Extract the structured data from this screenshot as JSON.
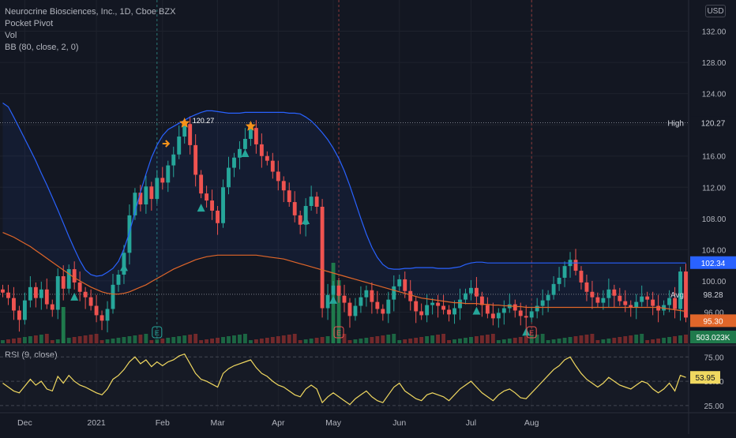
{
  "legend": {
    "title": "Neurocrine Biosciences, Inc., 1D, Cboe BZX",
    "indicator1": "Pocket Pivot",
    "indicator2": "Vol",
    "indicator3": "BB (80, close, 2, 0)"
  },
  "currency_button": "USD",
  "colors": {
    "background": "#131722",
    "bb_band": "#2962ff",
    "bb_basis": "#e0662a",
    "up": "#26a69a",
    "down": "#ef5350",
    "rsi": "#f0d860",
    "high_line": "#2962ff",
    "earnings": "#ef5350"
  },
  "chart_data": [
    {
      "type": "candlestick",
      "ylim": [
        92,
        136
      ],
      "y_ticks": [
        "132.00",
        "128.00",
        "124.00",
        "120.00",
        "116.00",
        "112.00",
        "108.00",
        "104.00",
        "100.00",
        "96.00"
      ],
      "x_ticks": [
        "Dec",
        "2021",
        "Feb",
        "Mar",
        "Apr",
        "May",
        "Jun",
        "Jul",
        "Aug"
      ],
      "price_labels": {
        "high_label": "High",
        "high_value": "120.27",
        "upper_band_value": "102.34",
        "avg_label": "Avg",
        "avg_value": "98.28",
        "last_value": "95.30",
        "volume_value": "503.023K"
      },
      "annotations": {
        "peak_label": "120.27",
        "earnings_marker": "E"
      },
      "series_close": [
        98.5,
        97.8,
        96.2,
        95.0,
        97.5,
        99.2,
        97.8,
        98.9,
        97.0,
        96.3,
        100.6,
        99.0,
        101.5,
        99.8,
        98.6,
        97.9,
        96.8,
        95.6,
        94.9,
        96.4,
        99.5,
        100.8,
        103.6,
        108.4,
        111.3,
        109.8,
        112.1,
        110.5,
        113.2,
        112.6,
        114.8,
        116.2,
        118.5,
        120.1,
        117.4,
        113.6,
        111.2,
        110.3,
        109.0,
        107.4,
        112.0,
        114.5,
        115.8,
        116.9,
        118.2,
        119.6,
        117.5,
        116.0,
        115.4,
        114.0,
        112.8,
        111.6,
        110.1,
        108.4,
        107.2,
        109.6,
        110.8,
        109.5,
        96.5,
        98.2,
        99.4,
        98.1,
        97.2,
        95.5,
        96.8,
        97.9,
        98.8,
        97.3,
        96.4,
        95.8,
        97.6,
        99.3,
        100.2,
        98.7,
        97.4,
        96.1,
        95.6,
        96.9,
        97.2,
        96.8,
        96.3,
        95.7,
        96.5,
        97.6,
        98.4,
        99.1,
        98.0,
        96.9,
        95.8,
        95.2,
        95.9,
        96.5,
        97.0,
        96.2,
        95.5,
        95.3,
        96.1,
        96.8,
        97.5,
        98.2,
        99.6,
        100.4,
        101.9,
        102.7,
        101.3,
        99.8,
        98.6,
        97.9,
        97.2,
        97.8,
        98.9,
        98.1,
        97.4,
        96.9,
        96.6,
        97.3,
        98.0,
        97.6,
        96.8,
        96.2,
        96.9,
        97.8,
        96.4,
        101.2,
        95.3
      ],
      "series_upper_band": [
        122.8,
        122.3,
        121.0,
        119.6,
        118.2,
        116.8,
        115.4,
        113.8,
        112.3,
        110.7,
        109.1,
        107.4,
        105.7,
        104.1,
        102.6,
        101.4,
        100.8,
        100.6,
        100.7,
        101.1,
        101.6,
        102.5,
        104.1,
        106.2,
        108.8,
        111.4,
        113.7,
        115.8,
        117.4,
        118.6,
        119.4,
        119.8,
        120.2,
        120.6,
        121.0,
        121.3,
        121.6,
        121.8,
        121.8,
        121.7,
        121.6,
        121.5,
        121.5,
        121.5,
        121.6,
        121.6,
        121.6,
        121.6,
        121.6,
        121.6,
        121.6,
        121.6,
        121.5,
        121.5,
        121.4,
        121.0,
        120.5,
        119.8,
        119.0,
        118.1,
        117.0,
        115.7,
        114.1,
        112.2,
        110.1,
        108.0,
        106.0,
        104.3,
        103.0,
        102.1,
        101.6,
        101.5,
        101.5,
        101.6,
        101.6,
        101.7,
        101.7,
        101.7,
        101.7,
        101.6,
        101.6,
        101.6,
        101.7,
        101.8,
        102.1,
        102.3,
        102.4,
        102.4,
        102.3,
        102.3,
        102.3,
        102.3,
        102.3,
        102.3,
        102.3,
        102.3,
        102.3,
        102.3,
        102.3,
        102.3,
        102.3,
        102.3,
        102.3,
        102.3,
        102.3,
        102.3,
        102.3,
        102.3,
        102.3,
        102.3,
        102.3,
        102.3,
        102.3,
        102.3,
        102.3,
        102.3,
        102.3,
        102.3,
        102.3,
        102.3,
        102.3,
        102.3,
        102.3,
        102.3,
        102.3
      ],
      "series_basis": [
        106.2,
        105.9,
        105.6,
        105.2,
        104.8,
        104.4,
        103.9,
        103.4,
        102.9,
        102.4,
        101.9,
        101.4,
        100.9,
        100.4,
        100.0,
        99.6,
        99.2,
        98.9,
        98.6,
        98.4,
        98.3,
        98.3,
        98.4,
        98.6,
        98.9,
        99.2,
        99.5,
        99.9,
        100.3,
        100.7,
        101.1,
        101.5,
        101.8,
        102.1,
        102.4,
        102.7,
        102.9,
        103.1,
        103.2,
        103.3,
        103.3,
        103.3,
        103.3,
        103.3,
        103.3,
        103.3,
        103.3,
        103.2,
        103.1,
        103.0,
        102.9,
        102.8,
        102.6,
        102.4,
        102.2,
        102.0,
        101.8,
        101.6,
        101.4,
        101.2,
        101.0,
        100.8,
        100.6,
        100.4,
        100.2,
        100.0,
        99.8,
        99.6,
        99.4,
        99.2,
        99.0,
        98.8,
        98.6,
        98.4,
        98.2,
        98.0,
        97.8,
        97.7,
        97.6,
        97.5,
        97.4,
        97.3,
        97.2,
        97.2,
        97.1,
        97.1,
        97.1,
        97.0,
        97.0,
        96.9,
        96.9,
        96.8,
        96.8,
        96.7,
        96.7,
        96.6,
        96.6,
        96.6,
        96.6,
        96.6,
        96.6,
        96.6,
        96.6,
        96.6,
        96.6,
        96.6,
        96.6,
        96.6,
        96.6,
        96.6,
        96.6,
        96.6,
        96.6,
        96.6,
        96.6,
        96.6,
        96.6,
        96.6,
        96.6,
        96.6,
        96.5,
        96.4,
        96.3,
        96.2,
        96.1
      ]
    },
    {
      "type": "line",
      "name": "RSI (9, close)",
      "ylim": [
        20,
        85
      ],
      "y_ticks": [
        "75.00",
        "50.00",
        "25.00"
      ],
      "last_value": "53.95",
      "values": [
        48,
        44,
        40,
        38,
        45,
        52,
        46,
        50,
        42,
        40,
        55,
        48,
        56,
        50,
        46,
        44,
        41,
        38,
        36,
        42,
        52,
        56,
        62,
        70,
        75,
        68,
        72,
        65,
        70,
        66,
        70,
        72,
        76,
        78,
        68,
        58,
        52,
        50,
        47,
        44,
        58,
        63,
        66,
        68,
        70,
        72,
        64,
        58,
        55,
        50,
        46,
        44,
        40,
        36,
        34,
        42,
        46,
        42,
        28,
        34,
        38,
        34,
        30,
        26,
        32,
        36,
        40,
        34,
        30,
        28,
        36,
        44,
        48,
        40,
        36,
        32,
        30,
        36,
        38,
        36,
        34,
        30,
        36,
        42,
        46,
        50,
        44,
        38,
        34,
        30,
        36,
        40,
        42,
        38,
        33,
        32,
        38,
        44,
        50,
        56,
        62,
        66,
        72,
        75,
        66,
        58,
        52,
        48,
        44,
        48,
        54,
        50,
        46,
        44,
        42,
        46,
        50,
        48,
        42,
        38,
        42,
        48,
        40,
        56,
        54
      ]
    }
  ]
}
